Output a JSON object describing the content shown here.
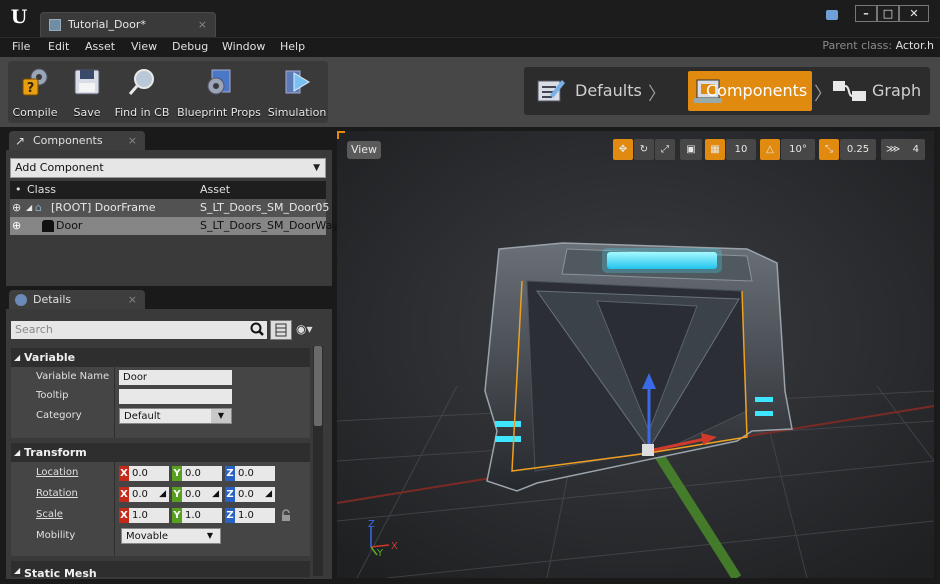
{
  "app": {
    "logo": "U",
    "tab_title": "Tutorial_Door*",
    "tab_close": "×",
    "parent_label": "Parent class:",
    "parent_value": "Actor.h"
  },
  "window_buttons": {
    "minimize": "–",
    "maximize": "□",
    "close": "✕"
  },
  "menu": [
    "File",
    "Edit",
    "Asset",
    "View",
    "Debug",
    "Window",
    "Help"
  ],
  "toolbar": [
    {
      "label": "Compile",
      "icon": "compile-icon"
    },
    {
      "label": "Save",
      "icon": "save-icon"
    },
    {
      "label": "Find in CB",
      "icon": "find-icon"
    },
    {
      "label": "Blueprint Props",
      "icon": "blueprint-props-icon"
    },
    {
      "label": "Simulation",
      "icon": "simulation-icon"
    }
  ],
  "modes": {
    "defaults": "Defaults",
    "components": "Components",
    "graph": "Graph",
    "active": "Components"
  },
  "components_panel": {
    "tab": "Components",
    "add_component": "Add Component",
    "col_class": "Class",
    "col_asset": "Asset",
    "rows": [
      {
        "class": "[ROOT] DoorFrame",
        "asset": "S_LT_Doors_SM_Door05"
      },
      {
        "class": "Door",
        "asset": "S_LT_Doors_SM_DoorWay("
      }
    ]
  },
  "details_panel": {
    "tab": "Details",
    "search_placeholder": "Search",
    "variable": {
      "header": "Variable",
      "name_label": "Variable Name",
      "name_value": "Door",
      "tooltip_label": "Tooltip",
      "tooltip_value": "",
      "category_label": "Category",
      "category_value": "Default"
    },
    "transform": {
      "header": "Transform",
      "location_label": "Location",
      "location": {
        "x": "0.0",
        "y": "0.0",
        "z": "0.0"
      },
      "rotation_label": "Rotation",
      "rotation": {
        "x": "0.0",
        "y": "0.0",
        "z": "0.0"
      },
      "scale_label": "Scale",
      "scale": {
        "x": "1.0",
        "y": "1.0",
        "z": "1.0"
      },
      "mobility_label": "Mobility",
      "mobility_value": "Movable"
    },
    "static_mesh_header": "Static Mesh",
    "axis_letters": {
      "x": "X",
      "y": "Y",
      "z": "Z"
    }
  },
  "viewport": {
    "view_button": "View",
    "grid_snap": "10",
    "rot_snap": "10°",
    "scale_snap": "0.25",
    "camera_speed": "4",
    "axis_labels": {
      "x": "X",
      "y": "Y",
      "z": "Z"
    }
  },
  "colors": {
    "accent": "#e08a10",
    "axis_x": "#c42a1a",
    "axis_y": "#58a020",
    "axis_z": "#2a62c4",
    "glow": "#3ee6ff"
  }
}
